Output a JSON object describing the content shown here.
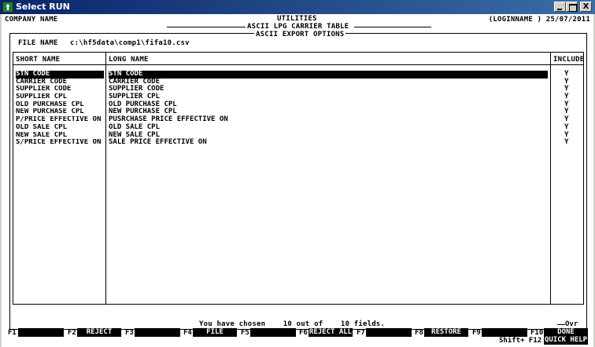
{
  "window": {
    "title": "Select RUN",
    "min": "_",
    "max": "",
    "close": "X"
  },
  "header": {
    "company": "COMPANY NAME",
    "title": "UTILITIES",
    "user_date": "(LOGINNAME ) 25/07/2011",
    "subtitle": "ASCII LPG CARRIER TABLE",
    "options": "ASCII EXPORT OPTIONS"
  },
  "file": {
    "label": "FILE NAME",
    "value": "c:\\hf5data\\comp1\\fifa10.csv"
  },
  "columns": {
    "short": "SHORT NAME",
    "long": "LONG NAME",
    "include": "INCLUDE"
  },
  "rows": [
    {
      "short": "STN CODE",
      "long": "STN CODE",
      "include": "Y"
    },
    {
      "short": "CARRIER CODE",
      "long": "CARRIER CODE",
      "include": "Y"
    },
    {
      "short": "SUPPLIER CODE",
      "long": "SUPPLIER CODE",
      "include": "Y"
    },
    {
      "short": "SUPPLIER CPL",
      "long": "SUPPLIER CPL",
      "include": "Y"
    },
    {
      "short": "OLD PURCHASE CPL",
      "long": "OLD PURCHASE CPL",
      "include": "Y"
    },
    {
      "short": "NEW PURCHASE CPL",
      "long": "NEW PURCHASE CPL",
      "include": "Y"
    },
    {
      "short": "P/PRICE EFFECTIVE ON",
      "long": "PUSRCHASE PRICE EFFECTIVE ON",
      "include": "Y"
    },
    {
      "short": "OLD SALE CPL",
      "long": "OLD SALE CPL",
      "include": "Y"
    },
    {
      "short": "NEW SALE CPL",
      "long": "NEW SALE CPL",
      "include": "Y"
    },
    {
      "short": "S/PRICE EFFECTIVE ON",
      "long": "SALE PRICE EFFECTIVE ON",
      "include": "Y"
    }
  ],
  "status": {
    "prefix": "You have chosen",
    "chosen": "10",
    "middle": "out of",
    "total": "10",
    "suffix": "fields."
  },
  "fkeys": {
    "f1": "F1",
    "f1_label": "",
    "f2": "F2",
    "f2_label": "REJECT",
    "f3": "F3",
    "f3_label": "",
    "f4": "F4",
    "f4_label": "FILE",
    "f5": "F5",
    "f5_label": "",
    "f6": "F6",
    "f6_label": "REJECT ALL",
    "f7": "F7",
    "f7_label": "",
    "f8": "F8",
    "f8_label": "RESTORE",
    "f9": "F9",
    "f9_label": "",
    "f10": "F10",
    "f10_label": "DONE",
    "ovr": "Ovr",
    "shift": "Shift+ F12",
    "f12_label": "QUICK HELP"
  }
}
